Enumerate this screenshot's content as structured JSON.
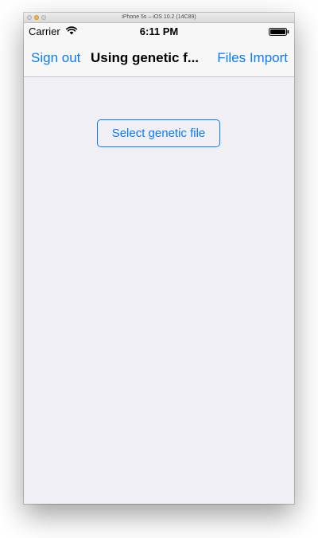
{
  "window": {
    "title": "iPhone 5s – iOS 10.2 (14C89)"
  },
  "status_bar": {
    "carrier": "Carrier",
    "time": "6:11 PM",
    "wifi_icon": "wifi-icon",
    "battery_icon": "battery-icon"
  },
  "nav_bar": {
    "left_button": "Sign out",
    "title": "Using genetic f...",
    "right_button": "Files Import"
  },
  "main": {
    "select_button": "Select genetic file"
  },
  "colors": {
    "tint": "#0a7aff",
    "background": "#efeff4",
    "bar_background": "#f7f7f7"
  }
}
